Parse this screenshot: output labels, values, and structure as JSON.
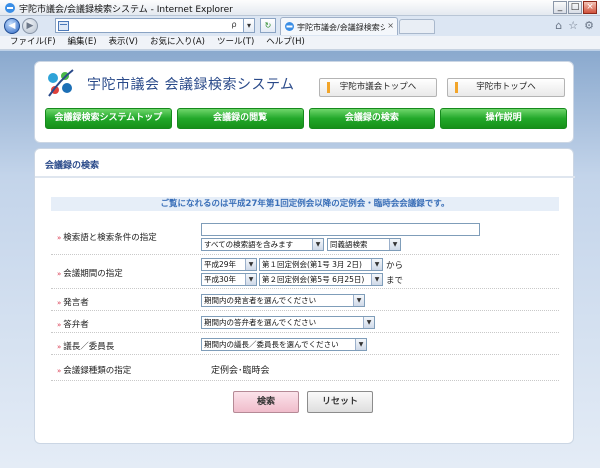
{
  "browser": {
    "window_title": "宇陀市議会/会議録検索システム - Internet Explorer",
    "tab_title": "宇陀市議会/会議録検索シ...",
    "tab_close": "×",
    "address_ctl_search": "ρ",
    "address_ctl_dropdown": "▾",
    "address_ctl_refresh": "↻",
    "back_glyph": "◀",
    "forward_glyph": "▶",
    "right_icons": [
      "⌂",
      "☆",
      "⚙"
    ],
    "window_buttons": [
      "_",
      "□",
      "×"
    ],
    "menu": [
      "ファイル(F)",
      "編集(E)",
      "表示(V)",
      "お気に入り(A)",
      "ツール(T)",
      "ヘルプ(H)"
    ]
  },
  "header": {
    "site_title": "宇陀市議会  会議録検索システム",
    "link_council_top": "宇陀市議会トップへ",
    "link_city_top": "宇陀市トップへ",
    "nav": [
      "会議録検索システムトップ",
      "会議録の閲覧",
      "会議録の検索",
      "操作説明"
    ]
  },
  "search": {
    "section_title": "会議録の検索",
    "notice": "ご覧になれるのは平成27年第1回定例会以降の定例会・臨時会会議録です。",
    "arrow": "»",
    "rows": {
      "keyword": {
        "label": "検索語と検索条件の指定",
        "input_value": "",
        "condition": "すべての検索語を含みます",
        "synonym": "同義語検索"
      },
      "period": {
        "label": "会議期間の指定",
        "from_year": "平成29年",
        "from_session": "第１回定例会(第1号 3月 2日)",
        "from_suffix": "から",
        "to_year": "平成30年",
        "to_session": "第２回定例会(第5号 6月25日)",
        "to_suffix": "まで"
      },
      "speaker": {
        "label": "発言者",
        "value": "期間内の発言者を選んでください"
      },
      "answerer": {
        "label": "答弁者",
        "value": "期間内の答弁者を選んでください"
      },
      "chair": {
        "label": "議長／委員長",
        "value": "期間内の議長／委員長を選んでください"
      },
      "type": {
        "label": "会議録種類の指定",
        "value": "定例会･臨時会"
      }
    },
    "buttons": {
      "search": "検索",
      "reset": "リセット"
    }
  },
  "colors": {
    "nav_green": "#22a82a",
    "title_blue": "#2a4a8a",
    "notice_blue": "#3a6fb8",
    "label_arrow": "#d7334a"
  }
}
